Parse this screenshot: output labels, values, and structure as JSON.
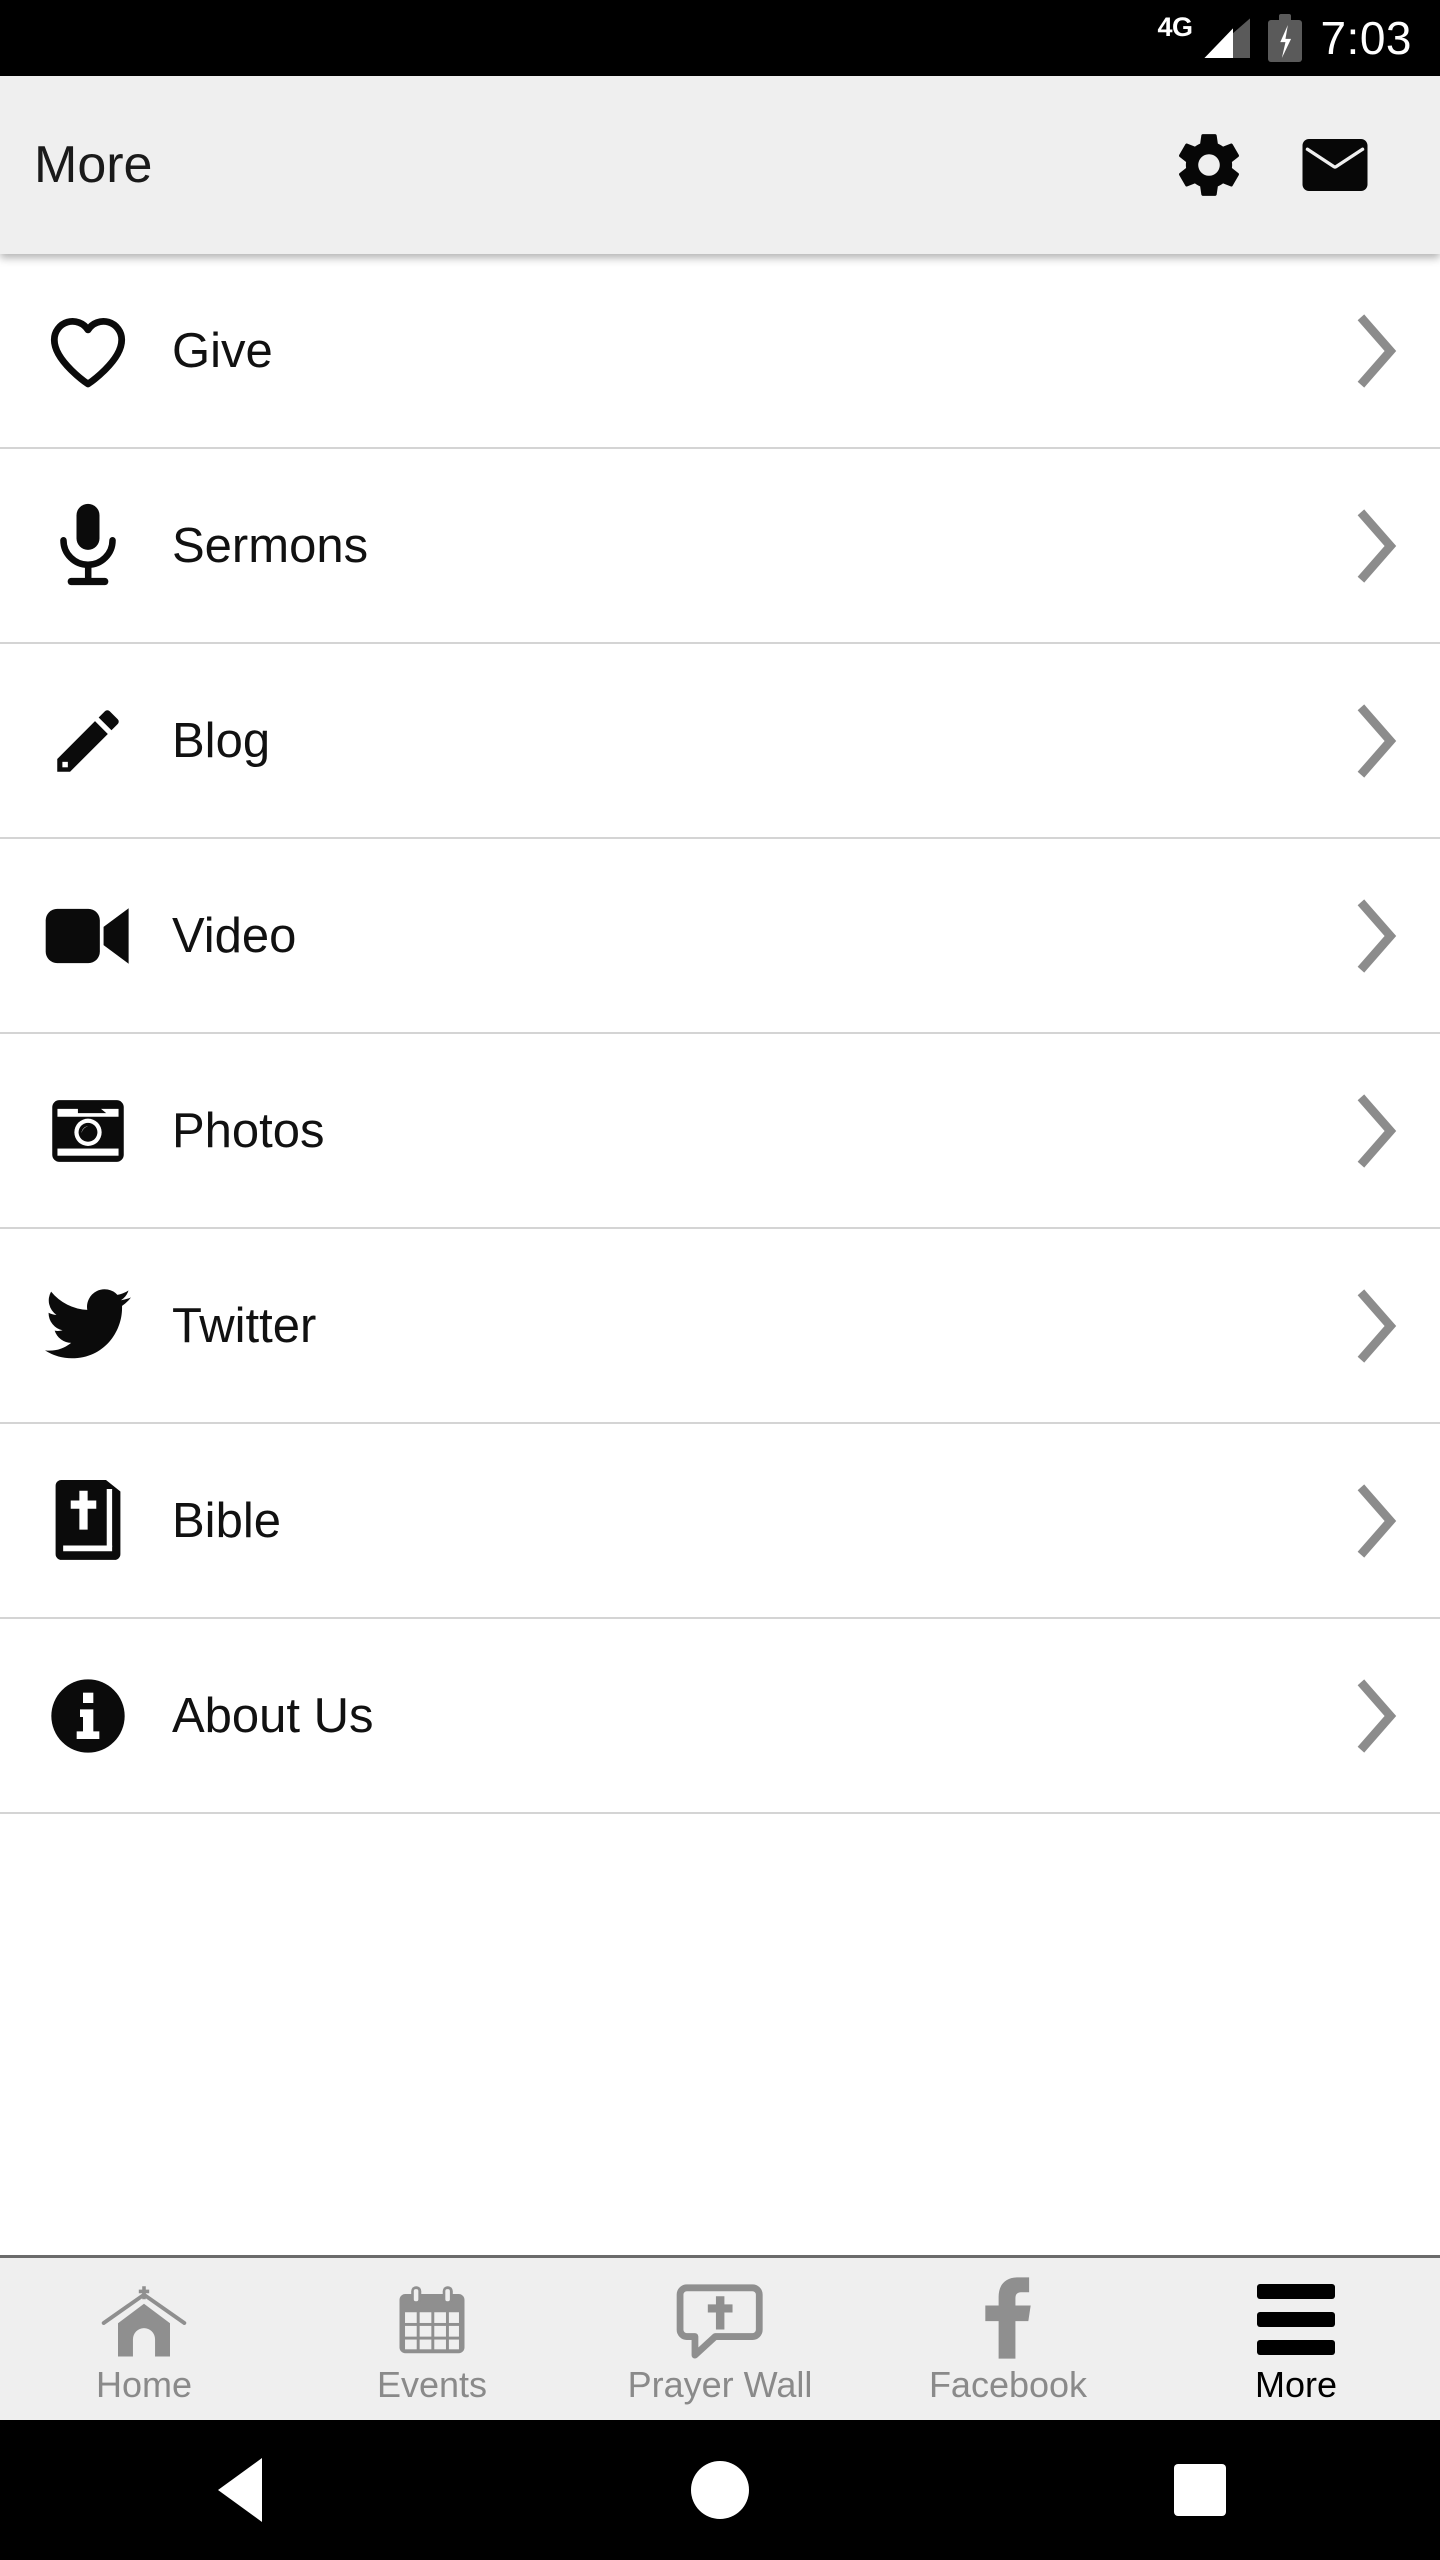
{
  "status_bar": {
    "network_type": "4G",
    "time": "7:03",
    "battery_state": "charging",
    "signal_icon": "signal-bars-icon",
    "battery_icon": "battery-charging-icon"
  },
  "app_bar": {
    "title": "More",
    "actions": [
      {
        "name": "settings-button",
        "icon": "gear-icon"
      },
      {
        "name": "mail-button",
        "icon": "envelope-icon"
      }
    ]
  },
  "menu": {
    "items": [
      {
        "label": "Give",
        "icon": "heart-outline-icon",
        "chevron": "chevron-right-icon"
      },
      {
        "label": "Sermons",
        "icon": "microphone-icon",
        "chevron": "chevron-right-icon"
      },
      {
        "label": "Blog",
        "icon": "pencil-icon",
        "chevron": "chevron-right-icon"
      },
      {
        "label": "Video",
        "icon": "video-camera-icon",
        "chevron": "chevron-right-icon"
      },
      {
        "label": "Photos",
        "icon": "camera-icon",
        "chevron": "chevron-right-icon"
      },
      {
        "label": "Twitter",
        "icon": "twitter-bird-icon",
        "chevron": "chevron-right-icon"
      },
      {
        "label": "Bible",
        "icon": "bible-book-icon",
        "chevron": "chevron-right-icon"
      },
      {
        "label": "About Us",
        "icon": "info-circle-icon",
        "chevron": "chevron-right-icon"
      }
    ]
  },
  "tab_bar": {
    "tabs": [
      {
        "label": "Home",
        "icon": "church-icon",
        "active": false
      },
      {
        "label": "Events",
        "icon": "calendar-icon",
        "active": false
      },
      {
        "label": "Prayer Wall",
        "icon": "speech-cross-icon",
        "active": false
      },
      {
        "label": "Facebook",
        "icon": "facebook-f-icon",
        "active": false
      },
      {
        "label": "More",
        "icon": "hamburger-menu-icon",
        "active": true
      }
    ]
  },
  "nav_bar": {
    "buttons": [
      {
        "name": "back-button",
        "icon": "triangle-back-icon"
      },
      {
        "name": "home-button",
        "icon": "circle-home-icon"
      },
      {
        "name": "recents-button",
        "icon": "square-recents-icon"
      }
    ]
  },
  "colors": {
    "appbar_bg": "#efefef",
    "tabbar_bg": "#efefef",
    "divider": "#d4d4d4",
    "inactive_tab": "#8a8a8a",
    "active_tab": "#000000",
    "chevron": "#8c8c8c"
  }
}
